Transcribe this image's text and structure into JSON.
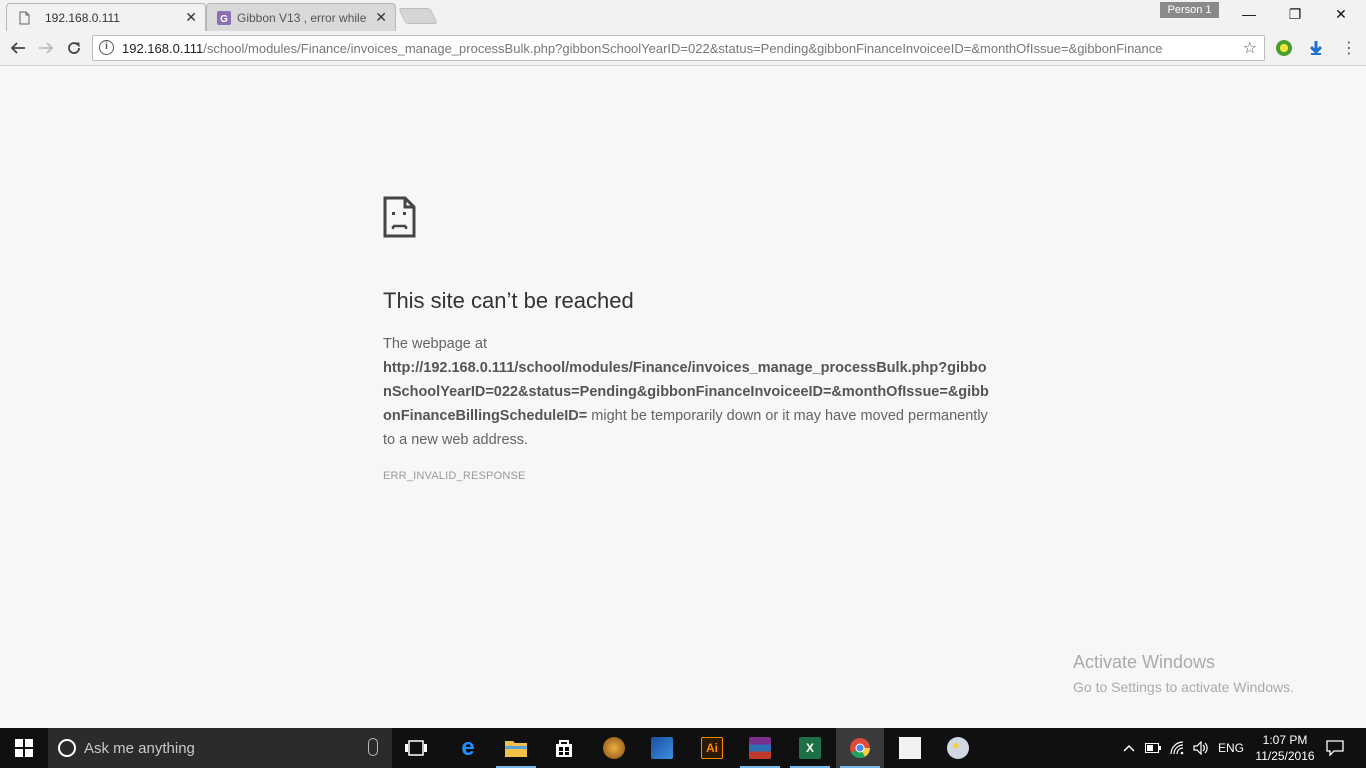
{
  "browser": {
    "tabs": [
      {
        "label": "192.168.0.111",
        "active": true
      },
      {
        "label": "Gibbon V13 , error while",
        "active": false
      }
    ],
    "profile_label": "Person 1",
    "window_controls": {
      "minimize": "—",
      "restore": "❐",
      "close": "✕"
    },
    "address": {
      "host": "192.168.0.111",
      "path": "/school/modules/Finance/invoices_manage_processBulk.php?gibbonSchoolYearID=022&status=Pending&gibbonFinanceInvoiceeID=&monthOfIssue=&gibbonFinance"
    }
  },
  "error_page": {
    "title": "This site can’t be reached",
    "intro": "The webpage at",
    "url_bold": "http://192.168.0.111/school/modules/Finance/invoices_manage_processBulk.php?gibbonSchoolYearID=022&status=Pending&gibbonFinanceInvoiceeID=&monthOfIssue=&gibbonFinanceBillingScheduleID=",
    "message_tail": " might be temporarily down or it may have moved permanently to a new web address.",
    "error_code": "ERR_INVALID_RESPONSE"
  },
  "watermark": {
    "line1": "Activate Windows",
    "line2": "Go to Settings to activate Windows."
  },
  "taskbar": {
    "search_placeholder": "Ask me anything",
    "apps": [
      {
        "name": "task-view-icon",
        "color": "#000000",
        "text": ""
      },
      {
        "name": "edge-icon",
        "color": "#0078d7",
        "text": "e"
      },
      {
        "name": "file-explorer-icon",
        "color": "#f3c04a",
        "text": ""
      },
      {
        "name": "store-icon",
        "color": "#ffffff",
        "text": ""
      },
      {
        "name": "app-icon-1",
        "color": "#b5651d",
        "text": ""
      },
      {
        "name": "app-icon-2",
        "color": "#1a4fa0",
        "text": ""
      },
      {
        "name": "illustrator-icon",
        "color": "#2b1a05",
        "text": "Ai"
      },
      {
        "name": "winrar-icon",
        "color": "#7a2e8e",
        "text": ""
      },
      {
        "name": "excel-icon",
        "color": "#1d7044",
        "text": "X"
      },
      {
        "name": "chrome-icon",
        "color": "#dd4b39",
        "text": ""
      },
      {
        "name": "notepad-icon",
        "color": "#e8e8e8",
        "text": ""
      },
      {
        "name": "paint-icon",
        "color": "#cfd8e3",
        "text": ""
      }
    ],
    "tray": {
      "language": "ENG",
      "time": "1:07 PM",
      "date": "11/25/2016"
    }
  }
}
